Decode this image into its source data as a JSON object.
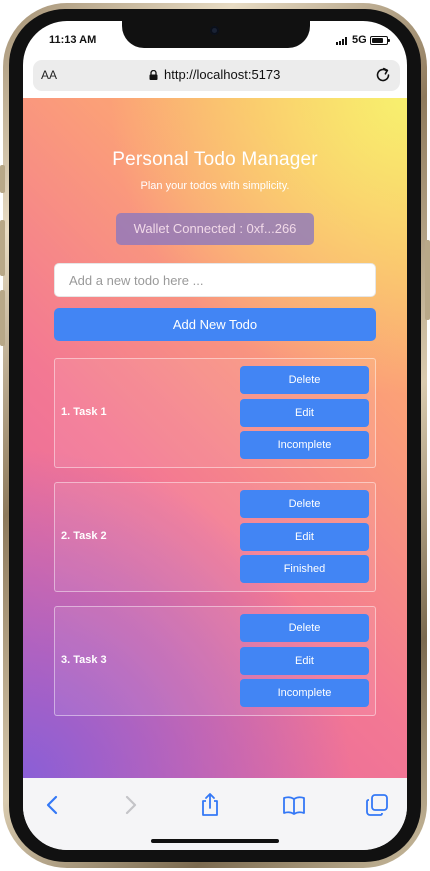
{
  "status_bar": {
    "time": "11:13 AM",
    "network": "5G"
  },
  "browser": {
    "text_size_label": "AA",
    "url": "http://localhost:5173"
  },
  "app": {
    "title": "Personal Todo Manager",
    "subtitle": "Plan your todos with simplicity.",
    "wallet_status": "Wallet Connected : 0xf...266",
    "input_placeholder": "Add a new todo here ...",
    "add_button_label": "Add New Todo",
    "todos": [
      {
        "label": "1. Task 1",
        "delete_label": "Delete",
        "edit_label": "Edit",
        "status_label": "Incomplete"
      },
      {
        "label": "2. Task 2",
        "delete_label": "Delete",
        "edit_label": "Edit",
        "status_label": "Finished"
      },
      {
        "label": "3. Task 3",
        "delete_label": "Delete",
        "edit_label": "Edit",
        "status_label": "Incomplete"
      }
    ]
  },
  "toolbar": {
    "icons": [
      "back-icon",
      "forward-icon",
      "share-icon",
      "bookmarks-icon",
      "tabs-icon"
    ]
  },
  "colors": {
    "accent": "#4285f4",
    "browser_icon": "#3478f6",
    "disabled_icon": "#c4c4c8"
  }
}
